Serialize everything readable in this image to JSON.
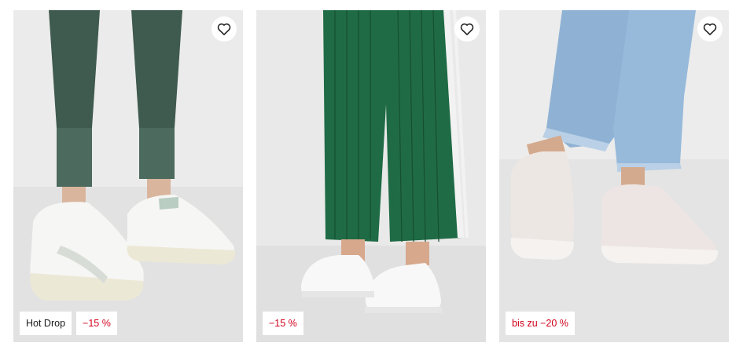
{
  "products": [
    {
      "wishlist_icon": "heart-outline-icon",
      "badges": [
        {
          "label": "Hot Drop",
          "type": "info"
        },
        {
          "label": "−15 %",
          "type": "sale"
        }
      ]
    },
    {
      "wishlist_icon": "heart-outline-icon",
      "badges": [
        {
          "label": "−15 %",
          "type": "sale"
        }
      ]
    },
    {
      "wishlist_icon": "heart-outline-icon",
      "badges": [
        {
          "label": "bis zu −20 %",
          "type": "sale"
        }
      ]
    }
  ],
  "colors": {
    "sale_text": "#d0021b",
    "badge_bg": "#ffffff",
    "card_bg": "#ececec"
  }
}
